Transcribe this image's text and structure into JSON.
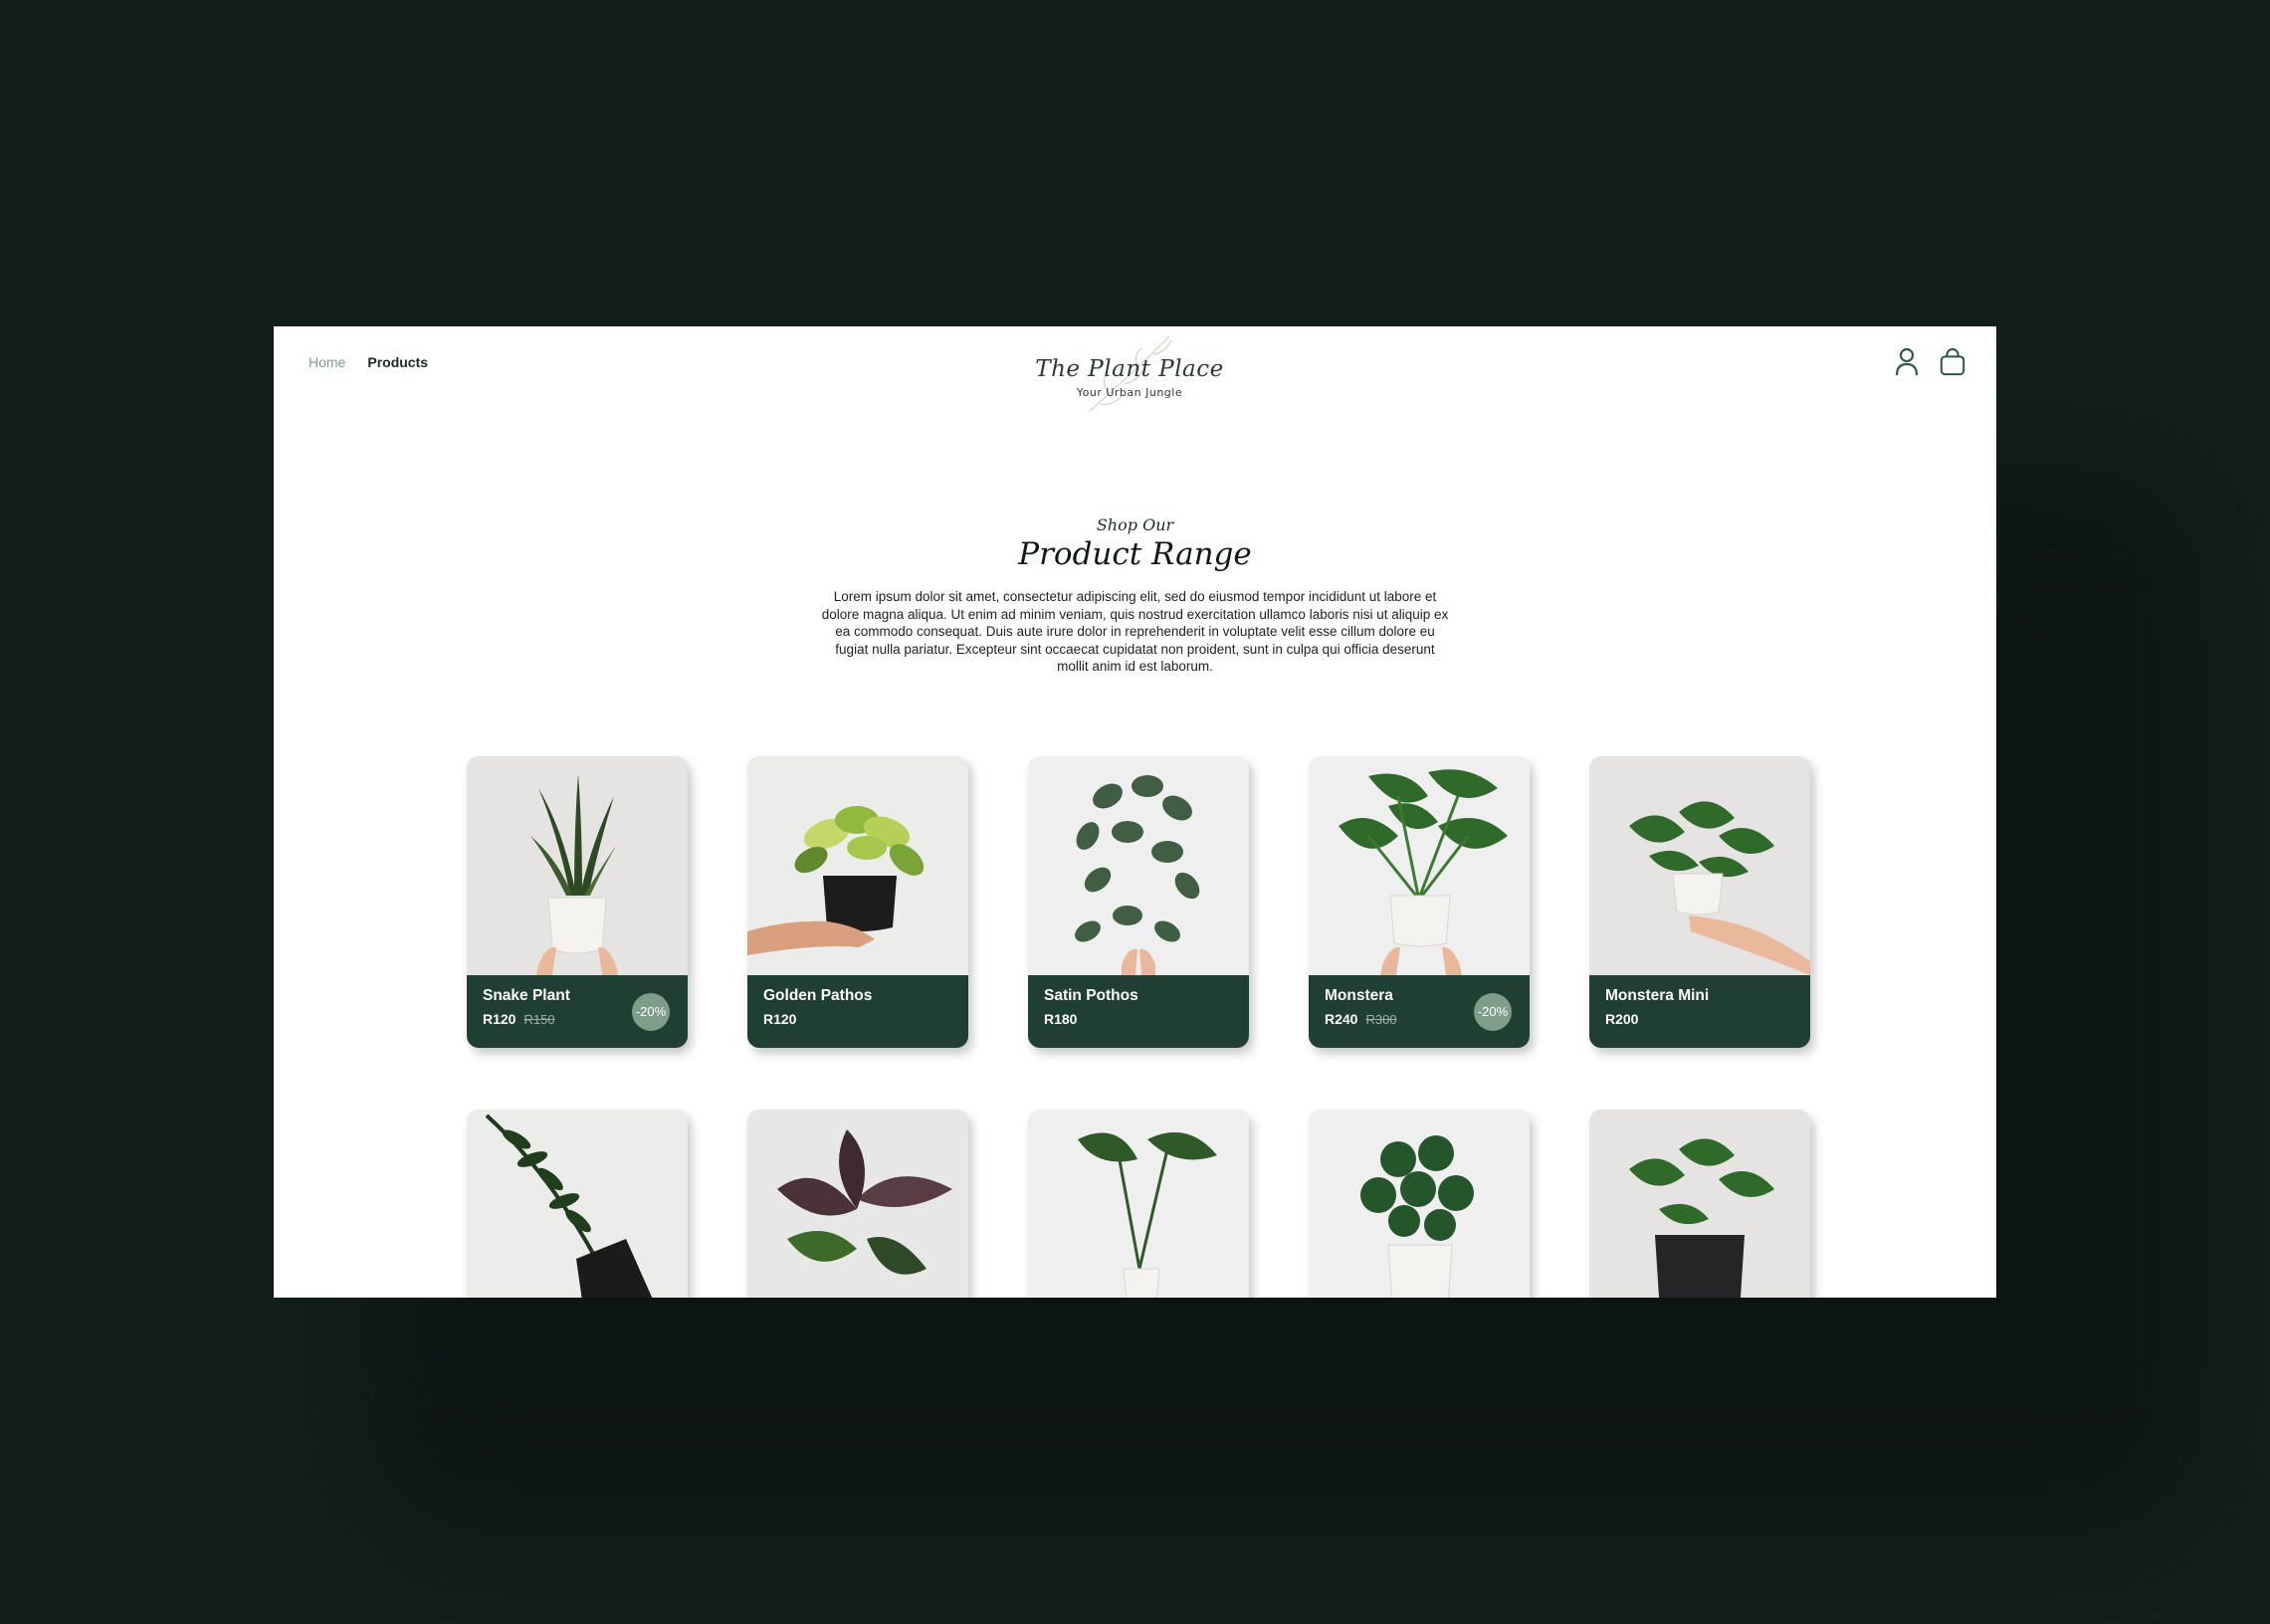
{
  "nav": {
    "home": "Home",
    "products": "Products"
  },
  "logo": {
    "title": "The Plant Place",
    "subtitle": "Your Urban Jungle"
  },
  "header_icons": [
    "user-icon",
    "shopping-bag-icon"
  ],
  "intro": {
    "eyebrow": "Shop Our",
    "title": "Product Range",
    "body": "Lorem ipsum dolor sit amet, consectetur adipiscing elit, sed do eiusmod tempor incididunt ut labore et dolore magna aliqua. Ut enim ad minim veniam, quis nostrud exercitation ullamco laboris nisi ut aliquip ex ea commodo consequat. Duis aute irure dolor in reprehenderit in voluptate velit esse cillum dolore eu fugiat nulla pariatur. Excepteur sint occaecat cupidatat non proident, sunt in culpa qui officia deserunt mollit anim id est laborum."
  },
  "products": [
    {
      "name": "Snake Plant",
      "price": "R120",
      "old_price": "R150",
      "badge": "-20%"
    },
    {
      "name": "Golden Pathos",
      "price": "R120"
    },
    {
      "name": "Satin Pothos",
      "price": "R180"
    },
    {
      "name": "Monstera",
      "price": "R240",
      "old_price": "R300",
      "badge": "-20%"
    },
    {
      "name": "Monstera Mini",
      "price": "R200"
    }
  ],
  "colors": {
    "background": "#121e1a",
    "card_footer": "#1f3f33",
    "badge": "#7e9e8a",
    "nav_home": "#7a9a86"
  }
}
